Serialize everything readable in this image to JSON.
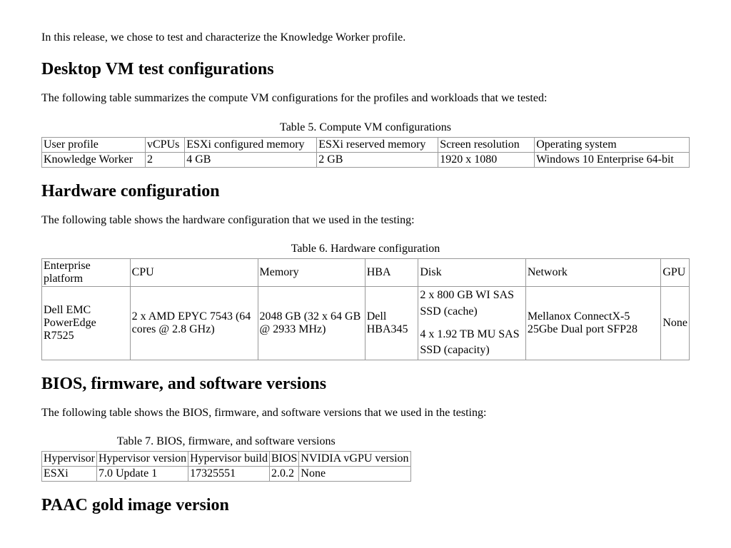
{
  "intro": "In this release, we chose to test and characterize the Knowledge Worker profile.",
  "sections": {
    "s1": {
      "heading": "Desktop VM test configurations",
      "para": "The following table summarizes the compute VM configurations for the profiles and workloads that we tested:",
      "caption": "Table 5. Compute VM configurations",
      "headers": [
        "User profile",
        "vCPUs",
        "ESXi configured memory",
        "ESXi reserved memory",
        "Screen resolution",
        "Operating system"
      ],
      "rows": [
        [
          "Knowledge Worker",
          "2",
          "4 GB",
          "2 GB",
          "1920 x 1080",
          "Windows 10 Enterprise 64-bit"
        ]
      ]
    },
    "s2": {
      "heading": "Hardware configuration",
      "para": "The following table shows the hardware configuration that we used in the testing:",
      "caption": "Table 6. Hardware configuration",
      "headers": [
        "Enterprise platform",
        "CPU",
        "Memory",
        "HBA",
        "Disk",
        "Network",
        "GPU"
      ],
      "row": {
        "platform": "Dell EMC PowerEdge R7525",
        "cpu": "2 x AMD EPYC 7543 (64 cores @ 2.8 GHz)",
        "memory": "2048 GB (32 x 64 GB @ 2933 MHz)",
        "hba": "Dell HBA345",
        "disk1": "2 x 800 GB WI SAS SSD (cache)",
        "disk2": "4 x 1.92 TB MU SAS SSD (capacity)",
        "network": "Mellanox ConnectX-5 25Gbe Dual port SFP28",
        "gpu": "None"
      }
    },
    "s3": {
      "heading": "BIOS, firmware, and software versions",
      "para": "The following table shows the BIOS, firmware, and software versions that we used in the testing:",
      "caption": "Table 7. BIOS, firmware, and software versions",
      "headers": [
        "Hypervisor",
        "Hypervisor version",
        "Hypervisor build",
        "BIOS",
        "NVIDIA vGPU version"
      ],
      "rows": [
        [
          "ESXi",
          "7.0 Update 1",
          "17325551",
          "2.0.2",
          "None"
        ]
      ]
    },
    "s4": {
      "heading": "PAAC gold image version"
    }
  }
}
